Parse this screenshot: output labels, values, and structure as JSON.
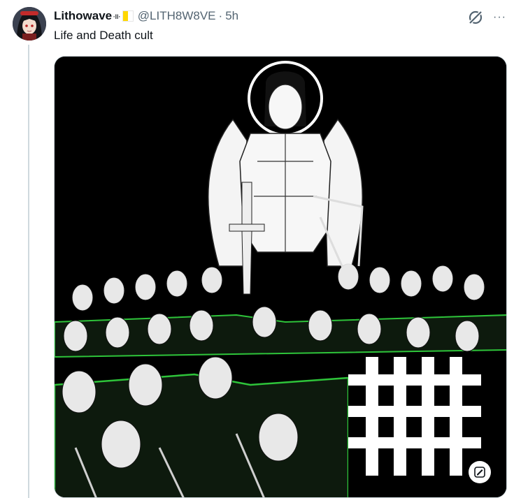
{
  "post": {
    "display_name": "Lithowave",
    "name_badge": "·ıı·",
    "handle": "@LITH8W8VE",
    "separator": "·",
    "time": "5h",
    "text": "Life and Death cult",
    "more_label": "···"
  },
  "icons": {
    "avatar": "avatar-anime-girl",
    "flag": "vatican-flag-icon",
    "grok": "grok-icon",
    "more": "more-options-icon",
    "media_action": "edit-image-icon"
  },
  "media": {
    "symbol": "#",
    "colors": {
      "background": "#000000",
      "accent": "#2ec43a",
      "figure": "#ffffff"
    }
  },
  "colors": {
    "text": "#0f1419",
    "secondary": "#536471",
    "thread_line": "#cfd9de"
  }
}
